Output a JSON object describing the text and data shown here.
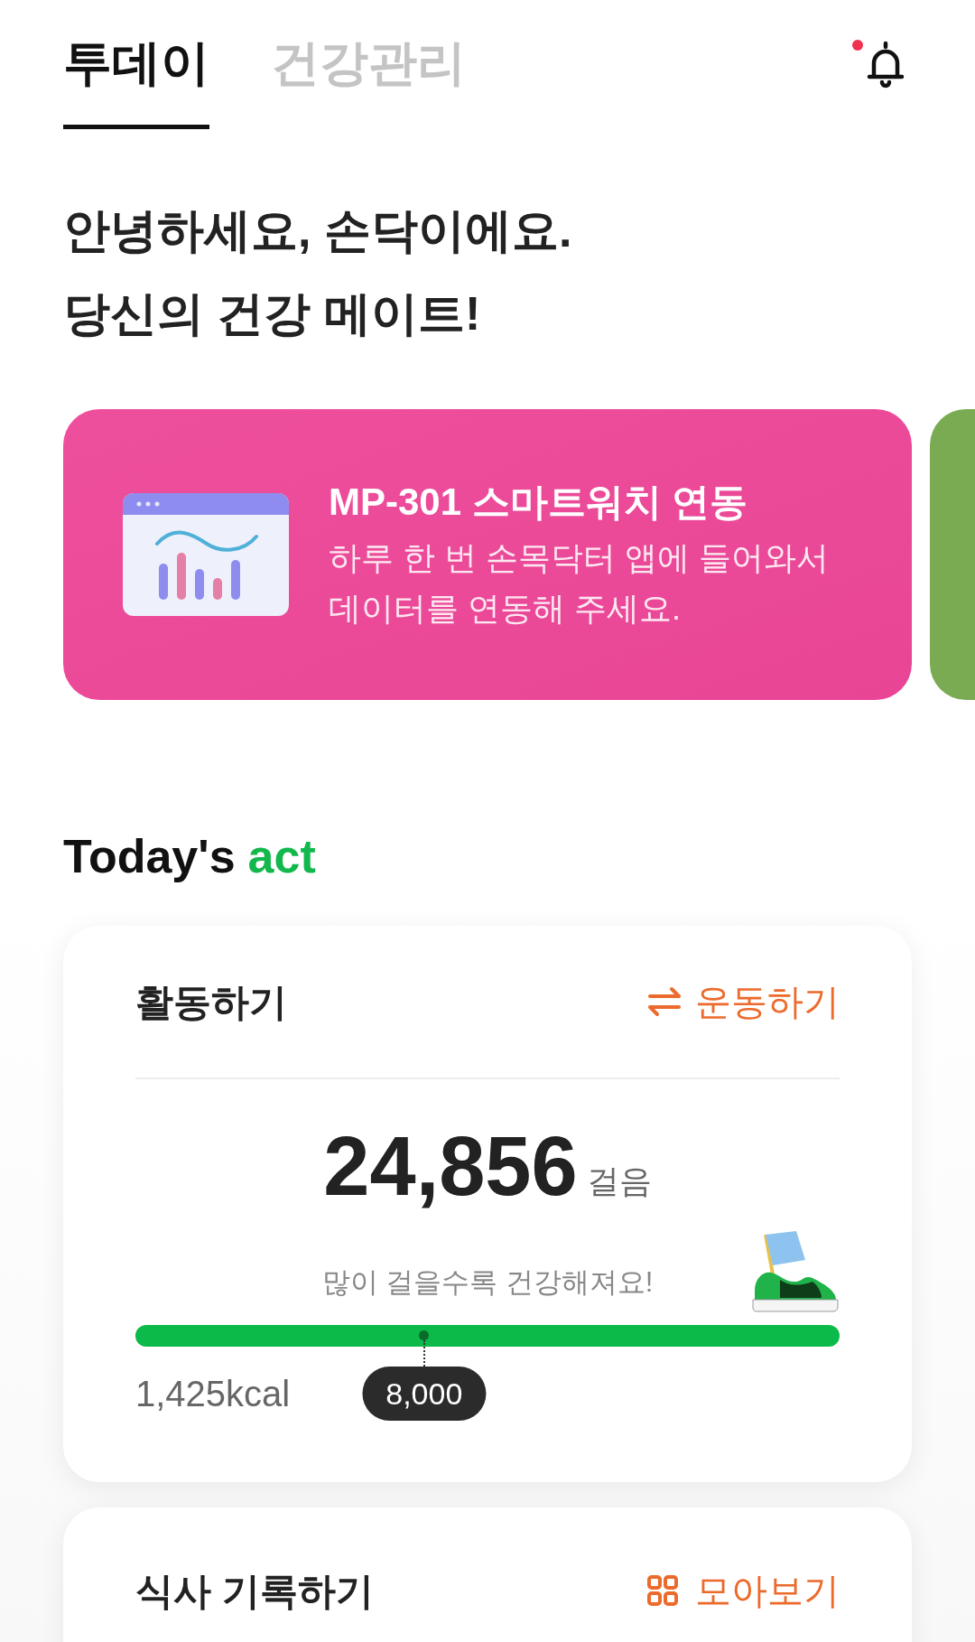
{
  "tabs": [
    {
      "label": "투데이",
      "selected": true
    },
    {
      "label": "건강관리",
      "selected": false
    }
  ],
  "notifications": {
    "unread": true
  },
  "greeting": [
    "안녕하세요, 손닥이에요.",
    "당신의 건강 메이트!"
  ],
  "banner": {
    "title": "MP-301 스마트워치 연동",
    "text": "하루 한 번 손목닥터 앱에 들어와서 데이터를 연동해 주세요."
  },
  "section_title": {
    "text": "Today's",
    "accent": "act"
  },
  "activity": {
    "title": "활동하기",
    "action": "운동하기",
    "steps": "24,856",
    "unit": "걸음",
    "message": "많이 걸을수록 건강해져요!",
    "level": 1,
    "calories": "1,425kcal",
    "goal": "8,000"
  },
  "meals": {
    "title": "식사 기록하기",
    "action": "모아보기"
  }
}
